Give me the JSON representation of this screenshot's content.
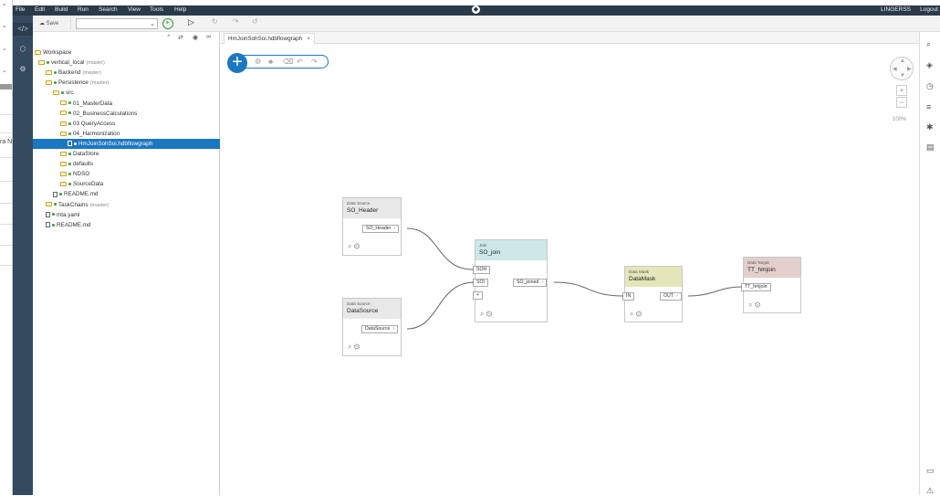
{
  "outer": {
    "fragment_text": "ra N"
  },
  "menubar": {
    "items": [
      "File",
      "Edit",
      "Build",
      "Run",
      "Search",
      "View",
      "Tools",
      "Help"
    ],
    "user": "LINGERSS",
    "logout": "Logout"
  },
  "toolbar": {
    "save_label": "Save"
  },
  "tab": {
    "title": "HmJoinSohSoi.hdbflowgraph",
    "close": "×"
  },
  "explorer": {
    "rows": [
      {
        "label": "Workspace",
        "tag": "",
        "kind": "folder"
      },
      {
        "label": "vertical_local",
        "tag": "(master)",
        "kind": "folder"
      },
      {
        "label": "Backend",
        "tag": "(master)",
        "kind": "folder"
      },
      {
        "label": "Persistence",
        "tag": "(master)",
        "kind": "folder"
      },
      {
        "label": "src",
        "tag": "",
        "kind": "folder"
      },
      {
        "label": "01_MasterData",
        "tag": "",
        "kind": "folder"
      },
      {
        "label": "02_BusinessCalculations",
        "tag": "",
        "kind": "folder"
      },
      {
        "label": "03 QueryAccess",
        "tag": "",
        "kind": "folder"
      },
      {
        "label": "04_Harmonization",
        "tag": "",
        "kind": "folder"
      },
      {
        "label": "HmJoinSohSoi.hdbflowgraph",
        "tag": "",
        "kind": "file"
      },
      {
        "label": "DataStore",
        "tag": "",
        "kind": "folder"
      },
      {
        "label": "defaults",
        "tag": "",
        "kind": "folder"
      },
      {
        "label": "NDSO",
        "tag": "",
        "kind": "folder"
      },
      {
        "label": "SourceData",
        "tag": "",
        "kind": "folder"
      },
      {
        "label": "README.md",
        "tag": "",
        "kind": "file"
      },
      {
        "label": "TaskChains",
        "tag": "(master)",
        "kind": "folder"
      },
      {
        "label": "mta.yaml",
        "tag": "",
        "kind": "file"
      },
      {
        "label": "README.md",
        "tag": "",
        "kind": "file"
      }
    ]
  },
  "canvas": {
    "zoom": "100%"
  },
  "nodes": {
    "so_header": {
      "type": "Data Source",
      "name": "SO_Header",
      "port": "SO_Header"
    },
    "datasource": {
      "type": "Data Source",
      "name": "DataSource",
      "port": "DataSource"
    },
    "join": {
      "type": "Join",
      "name": "SO_join",
      "in1": "SOH",
      "in2": "SOI",
      "out": "SO_joined",
      "add": "+"
    },
    "datamask": {
      "type": "Data Mask",
      "name": "DataMask",
      "in": "IN",
      "out": "OUT"
    },
    "target": {
      "type": "Data Target",
      "name": "TT_hmjoin",
      "in": "TT_hmjoin"
    }
  },
  "colors": {
    "menubar": "#2b3a49",
    "rail": "#354a5f",
    "accent": "#1b77c1",
    "join_header": "#cde8e6",
    "mask_header": "#e3e6b8",
    "target_header": "#e3cfcc",
    "source_header": "#e8e8e8"
  }
}
